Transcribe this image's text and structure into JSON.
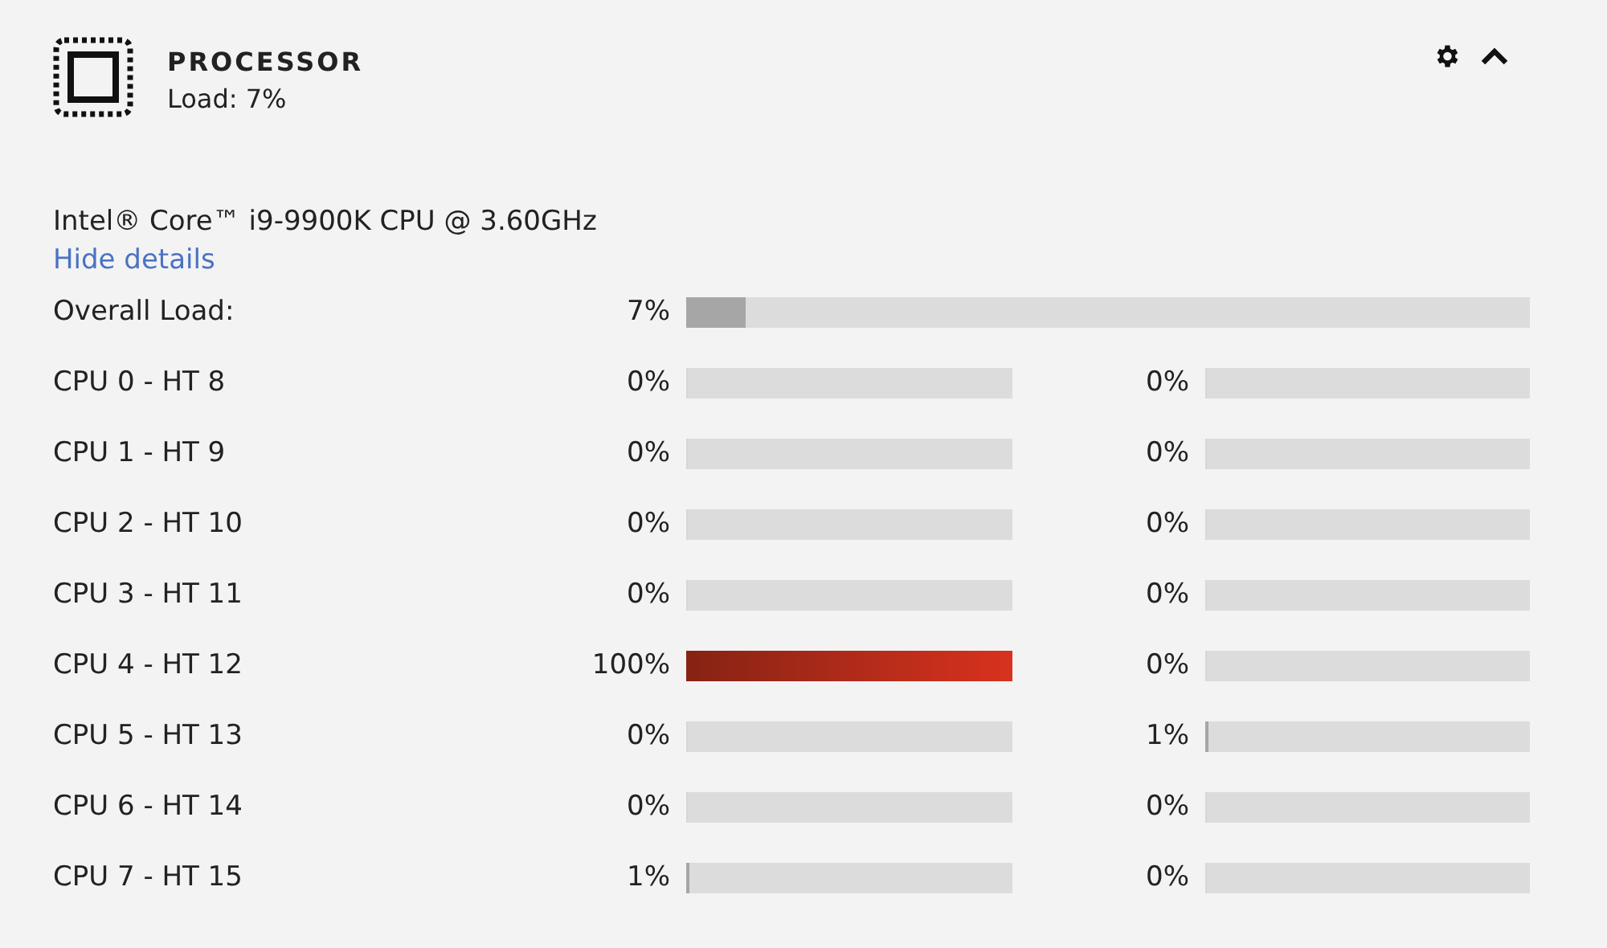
{
  "header": {
    "title": "PROCESSOR",
    "subtitle": "Load: 7%",
    "expanded": true
  },
  "cpu_name": "Intel® Core™ i9-9900K CPU @ 3.60GHz",
  "details_link": "Hide details",
  "overall": {
    "label": "Overall Load:",
    "reading": "7%",
    "level": 0.07
  },
  "cores": [
    {
      "label": "CPU 0 - HT 8",
      "threads": [
        {
          "reading": "0%",
          "level": 0
        },
        {
          "reading": "0%",
          "level": 0
        }
      ]
    },
    {
      "label": "CPU 1 - HT 9",
      "threads": [
        {
          "reading": "0%",
          "level": 0
        },
        {
          "reading": "0%",
          "level": 0
        }
      ]
    },
    {
      "label": "CPU 2 - HT 10",
      "threads": [
        {
          "reading": "0%",
          "level": 0
        },
        {
          "reading": "0%",
          "level": 0
        }
      ]
    },
    {
      "label": "CPU 3 - HT 11",
      "threads": [
        {
          "reading": "0%",
          "level": 0
        },
        {
          "reading": "0%",
          "level": 0
        }
      ]
    },
    {
      "label": "CPU 4 - HT 12",
      "threads": [
        {
          "reading": "100%",
          "level": 1
        },
        {
          "reading": "0%",
          "level": 0
        }
      ]
    },
    {
      "label": "CPU 5 - HT 13",
      "threads": [
        {
          "reading": "0%",
          "level": 0
        },
        {
          "reading": "1%",
          "level": 0.01
        }
      ]
    },
    {
      "label": "CPU 6 - HT 14",
      "threads": [
        {
          "reading": "0%",
          "level": 0
        },
        {
          "reading": "0%",
          "level": 0
        }
      ]
    },
    {
      "label": "CPU 7 - HT 15",
      "threads": [
        {
          "reading": "1%",
          "level": 0.01
        },
        {
          "reading": "0%",
          "level": 0
        }
      ]
    }
  ]
}
